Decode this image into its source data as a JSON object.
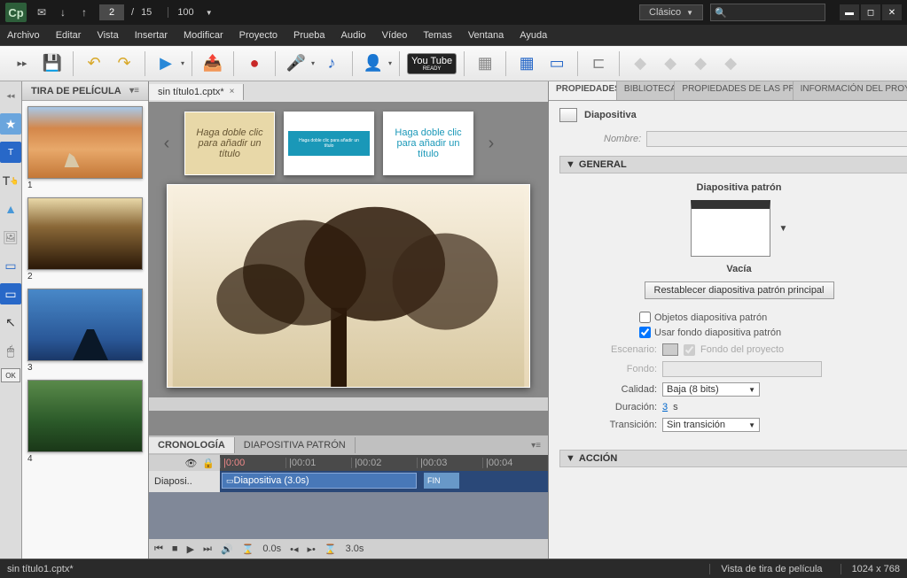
{
  "app": {
    "logo": "Cp"
  },
  "titlebar": {
    "page_current": "2",
    "page_sep": "/",
    "page_total": "15",
    "zoom": "100",
    "workspace": "Clásico"
  },
  "menu": {
    "items": [
      "Archivo",
      "Editar",
      "Vista",
      "Insertar",
      "Modificar",
      "Proyecto",
      "Prueba",
      "Audio",
      "Vídeo",
      "Temas",
      "Ventana",
      "Ayuda"
    ]
  },
  "toolbar": {
    "youtube": "You Tube",
    "youtube_sub": "READY"
  },
  "filmstrip": {
    "title": "TIRA DE PELÍCULA",
    "thumbs": [
      "1",
      "2",
      "3",
      "4"
    ]
  },
  "doc": {
    "filename": "sin título1.cptx*"
  },
  "templates": {
    "t1_text": "Haga doble clic para añadir un título",
    "t2_text": "Haga doble clic para añadir un título",
    "t3_text": "Haga doble clic para añadir un título"
  },
  "timeline": {
    "tab1": "CRONOLOGÍA",
    "tab2": "DIAPOSITIVA PATRÓN",
    "ticks": [
      "|0:00",
      "|00:01",
      "|00:02",
      "|00:03",
      "|00:04"
    ],
    "track_label": "Diaposi..",
    "clip_label": "Diapositiva (3.0s)",
    "fin_label": "FIN",
    "ctrl_time1": "0.0s",
    "ctrl_time2": "3.0s"
  },
  "properties": {
    "tab1": "PROPIEDADES",
    "tab2": "BIBLIOTECA",
    "tab3": "PROPIEDADES DE LAS PRUE",
    "tab4": "INFORMACIÓN DEL PROYEC",
    "slide_label": "Diapositiva",
    "name_label": "Nombre:",
    "general": {
      "title": "GENERAL",
      "master_label": "Diapositiva patrón",
      "master_name": "Vacía",
      "reset_btn": "Restablecer diapositiva patrón principal",
      "chk_objects": "Objetos diapositiva patrón",
      "chk_bg": "Usar fondo diapositiva patrón",
      "stage_label": "Escenario:",
      "chk_project_bg": "Fondo del proyecto",
      "bg_label": "Fondo:",
      "quality_label": "Calidad:",
      "quality_value": "Baja (8 bits)",
      "duration_label": "Duración:",
      "duration_value": "3",
      "duration_unit": "s",
      "transition_label": "Transición:",
      "transition_value": "Sin transición"
    },
    "action": {
      "title": "ACCIÓN"
    }
  },
  "statusbar": {
    "file": "sin título1.cptx*",
    "view": "Vista de tira de película",
    "dims": "1024 x 768"
  }
}
